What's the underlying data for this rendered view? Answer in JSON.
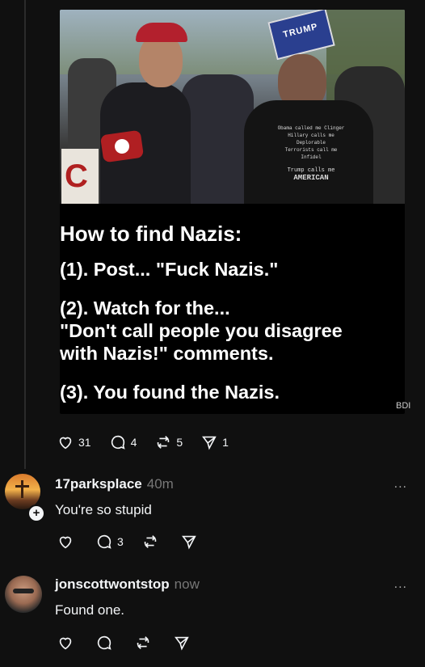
{
  "post": {
    "image": {
      "headline": "How to find Nazis:",
      "lines": [
        "(1). Post... \"Fuck Nazis.\"",
        "(2). Watch for the...",
        "\"Don't call people you disagree",
        "with Nazis!\" comments.",
        "(3). You found the Nazis."
      ],
      "sign_text": "TRUMP",
      "shirt_lines": [
        "Obama called me Clinger",
        "Hillary calls me Deplorable",
        "Terrorists call me Infidel",
        "Trump calls me",
        "AMERICAN"
      ],
      "banner_fragment": "C",
      "watermark": "BDI"
    },
    "stats": {
      "likes": "31",
      "replies": "4",
      "reposts": "5",
      "shares": "1"
    }
  },
  "replies": [
    {
      "username": "17parksplace",
      "time": "40m",
      "text": "You're so stupid",
      "stats": {
        "replies": "3"
      }
    },
    {
      "username": "jonscottwontstop",
      "time": "now",
      "text": "Found one."
    }
  ],
  "more_label": "...",
  "colors": {
    "background": "#101010",
    "text": "#f3f5f7",
    "muted": "#777777"
  }
}
